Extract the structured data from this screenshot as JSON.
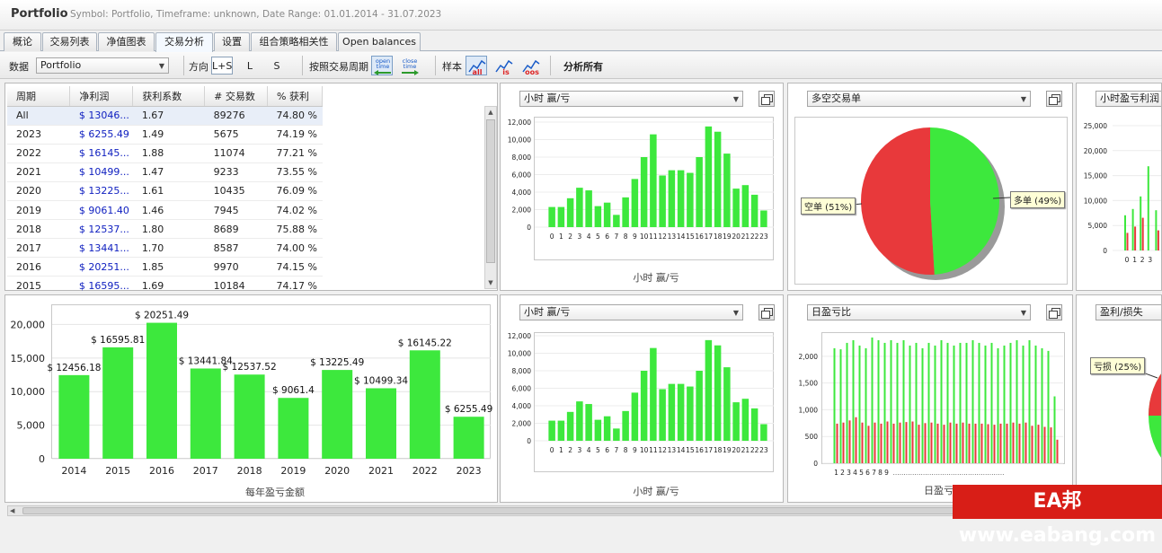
{
  "window": {
    "app_title": "Portfolio",
    "info": "Symbol: Portfolio, Timeframe: unknown, Date Range: 01.01.2014 - 31.07.2023"
  },
  "tabs": [
    {
      "label": "概论"
    },
    {
      "label": "交易列表"
    },
    {
      "label": "净值图表"
    },
    {
      "label": "交易分析",
      "active": true
    },
    {
      "label": "设置"
    },
    {
      "label": "组合策略相关性"
    },
    {
      "label": "Open balances"
    }
  ],
  "toolbar": {
    "data_label": "数据",
    "data_value": "Portfolio",
    "direction_label": "方向",
    "directions": [
      "L+S",
      "L",
      "S"
    ],
    "selected_direction": "L+S",
    "by_period_label": "按照交易周期",
    "open_time": "open time",
    "close_time": "close time",
    "sample_label": "样本",
    "samples": [
      "all",
      "is",
      "oos"
    ],
    "analyze_all": "分析所有"
  },
  "table": {
    "headers": [
      "周期",
      "净利润",
      "获利系数",
      "# 交易数",
      "% 获利"
    ],
    "rows": [
      [
        "All",
        "$ 13046...",
        "1.67",
        "89276",
        "74.80 %"
      ],
      [
        "2023",
        "$ 6255.49",
        "1.49",
        "5675",
        "74.19 %"
      ],
      [
        "2022",
        "$ 16145...",
        "1.88",
        "11074",
        "77.21 %"
      ],
      [
        "2021",
        "$ 10499...",
        "1.47",
        "9233",
        "73.55 %"
      ],
      [
        "2020",
        "$ 13225...",
        "1.61",
        "10435",
        "76.09 %"
      ],
      [
        "2019",
        "$ 9061.40",
        "1.46",
        "7945",
        "74.02 %"
      ],
      [
        "2018",
        "$ 12537...",
        "1.80",
        "8689",
        "75.88 %"
      ],
      [
        "2017",
        "$ 13441...",
        "1.70",
        "8587",
        "74.00 %"
      ],
      [
        "2016",
        "$ 20251...",
        "1.85",
        "9970",
        "74.15 %"
      ],
      [
        "2015",
        "$ 16595...",
        "1.69",
        "10184",
        "74.17 %"
      ]
    ]
  },
  "panels": {
    "hourly_top": {
      "selector": "小时 赢/亏",
      "caption": "小时 赢/亏"
    },
    "pie_top": {
      "selector": "多空交易单"
    },
    "partial_top": {
      "selector": "小时盈亏利润"
    },
    "hourly_bottom": {
      "selector": "小时 赢/亏",
      "caption": "小时 赢/亏"
    },
    "daily": {
      "selector": "日盈亏比",
      "caption": "日盈亏比"
    },
    "partial_bottom": {
      "selector": "盈利/损失"
    },
    "yearly": {
      "caption": "每年盈亏金额"
    }
  },
  "colors": {
    "green": "#3de83d",
    "red": "#e8393b"
  },
  "watermark": "EA邦 www.eabang.com",
  "chart_data": [
    {
      "type": "bar",
      "id": "yearly",
      "categories": [
        "2014",
        "2015",
        "2016",
        "2017",
        "2018",
        "2019",
        "2020",
        "2021",
        "2022",
        "2023"
      ],
      "values": [
        12456.18,
        16595.81,
        20251.49,
        13441.84,
        12537.52,
        9061.4,
        13225.49,
        10499.34,
        16145.22,
        6255.49
      ],
      "labels": [
        "$ 12456.18",
        "$ 16595.81",
        "$ 20251.49",
        "$ 13441.84",
        "$ 12537.52",
        "$ 9061.4",
        "$ 13225.49",
        "$ 10499.34",
        "$ 16145.22",
        "$ 6255.49"
      ],
      "xlabel": "每年盈亏金额",
      "yticks": [
        "0",
        "5,000",
        "10,000",
        "15,000",
        "20,000"
      ],
      "ylim": [
        0,
        23000
      ]
    },
    {
      "type": "bar",
      "id": "hourly",
      "categories": [
        "0",
        "1",
        "2",
        "3",
        "4",
        "5",
        "6",
        "7",
        "8",
        "9",
        "10",
        "11",
        "12",
        "13",
        "14",
        "15",
        "16",
        "17",
        "18",
        "19",
        "20",
        "21",
        "22",
        "23"
      ],
      "values": [
        2300,
        2300,
        3300,
        4500,
        4200,
        2400,
        2800,
        1400,
        3400,
        5500,
        8000,
        10600,
        5900,
        6500,
        6500,
        6200,
        8000,
        11500,
        10900,
        8400,
        4400,
        4800,
        3700,
        1900
      ],
      "yticks": [
        "0",
        "2,000",
        "4,000",
        "6,000",
        "8,000",
        "10,000",
        "12,000"
      ],
      "ylim": [
        0,
        12000
      ],
      "xlabel": "小时 赢/亏"
    },
    {
      "type": "pie",
      "id": "long_short",
      "slices": [
        {
          "name": "空单",
          "label": "空单 (51%)",
          "value": 51
        },
        {
          "name": "多单",
          "label": "多单 (49%)",
          "value": 49
        }
      ]
    },
    {
      "type": "bar",
      "id": "daily",
      "series": [
        {
          "name": "green",
          "values": [
            2150,
            2130,
            2250,
            2300,
            2200,
            2150,
            2350,
            2300,
            2250,
            2300,
            2250,
            2300,
            2200,
            2250,
            2150,
            2250,
            2200,
            2300,
            2250,
            2200,
            2250,
            2250,
            2300,
            2250,
            2200,
            2250,
            2150,
            2200,
            2250,
            2300,
            2200,
            2300,
            2200,
            2150,
            2100,
            1250
          ]
        },
        {
          "name": "red",
          "values": [
            740,
            760,
            800,
            860,
            760,
            700,
            760,
            740,
            780,
            740,
            760,
            770,
            780,
            720,
            750,
            760,
            740,
            720,
            760,
            740,
            760,
            740,
            740,
            740,
            730,
            720,
            740,
            740,
            760,
            740,
            760,
            700,
            720,
            680,
            670,
            440
          ]
        }
      ],
      "yticks": [
        "0",
        "500",
        "1,000",
        "1,500",
        "2,000"
      ],
      "ylim": [
        0,
        2400
      ],
      "xticks": [
        "1",
        "2",
        "3",
        "4",
        "5",
        "6",
        "7",
        "8",
        "9"
      ],
      "xlabel": "日盈亏比"
    },
    {
      "type": "bar",
      "id": "partial_top",
      "yticks": [
        "0",
        "5,000",
        "10,000",
        "15,000",
        "20,000",
        "25,000"
      ],
      "xticks": [
        "0",
        "1",
        "2",
        "3"
      ]
    },
    {
      "type": "pie",
      "id": "partial_bottom",
      "slices": [
        {
          "name": "亏损",
          "label": "亏损 (25%)",
          "value": 25
        }
      ]
    }
  ]
}
